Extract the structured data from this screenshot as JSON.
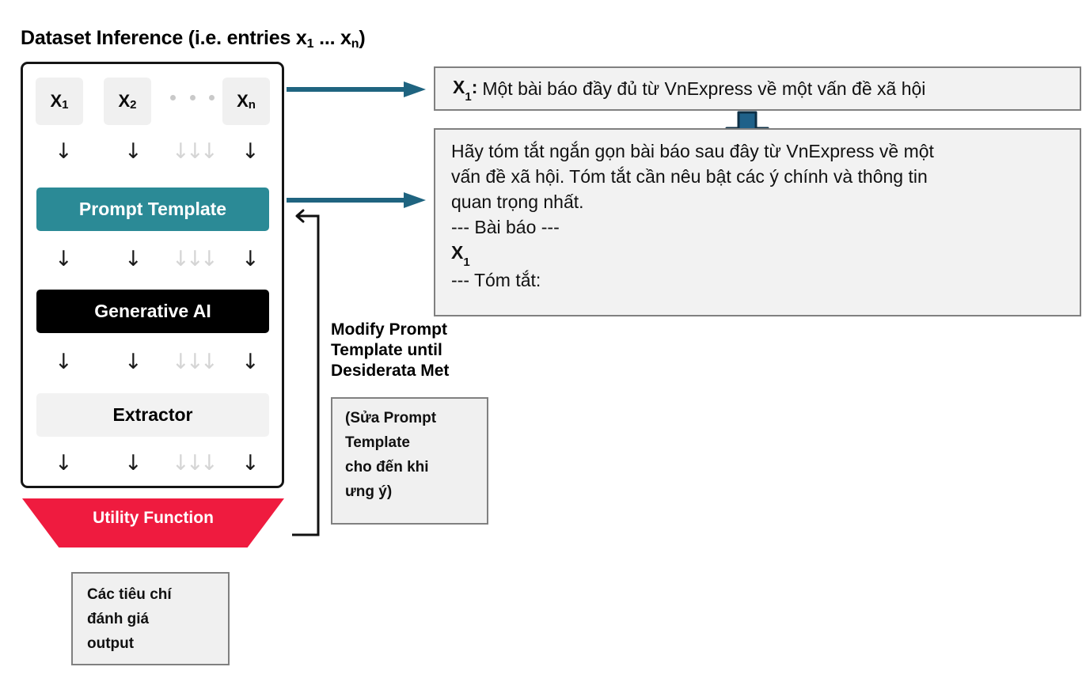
{
  "title": {
    "prefix": "Dataset Inference (i.e. entries x",
    "sub1": "1",
    "middle": " ... x",
    "sub2": "n",
    "suffix": ")",
    "full": "Dataset Inference (i.e. entries x1 ... xn)"
  },
  "pipeline": {
    "entries": [
      {
        "label": "X",
        "sub": "1"
      },
      {
        "label": "X",
        "sub": "2"
      },
      {
        "label": "X",
        "sub": "n"
      }
    ],
    "ellipsis": "• • •",
    "stages": [
      {
        "id": "prompt-template",
        "label": "Prompt Template",
        "color": "#2b8a96",
        "text_color": "#ffffff"
      },
      {
        "id": "generative-ai",
        "label": "Generative AI",
        "color": "#000000",
        "text_color": "#ffffff"
      },
      {
        "id": "extractor",
        "label": "Extractor",
        "color": "#f2f2f2",
        "text_color": "#000000"
      }
    ],
    "utility_function": {
      "label": "Utility Function",
      "color": "#ef1b3f",
      "text_color": "#ffffff"
    },
    "arrow_glyph": "↓"
  },
  "feedback": {
    "caption_line1": "Modify Prompt",
    "caption_line2": "Template until",
    "caption_line3": "Desiderata Met",
    "note_line1": "(Sửa Prompt",
    "note_line2": "Template",
    "note_line3": "cho đến khi",
    "note_line4": "ưng ý)"
  },
  "criteria": {
    "line1": "Các tiêu chí",
    "line2": "đánh giá",
    "line3": "output"
  },
  "example_entry": {
    "key": "X",
    "key_sub": "1",
    "colon": ":",
    "text": "Một bài báo đầy đủ từ VnExpress về một vấn đề xã hội"
  },
  "prompt_example": {
    "line1": "Hãy tóm tắt ngắn gọn bài báo sau đây từ VnExpress về một",
    "line2": "vấn đề xã hội. Tóm tắt cần nêu bật các ý chính và thông tin",
    "line3": "quan trọng nhất.",
    "line4": "--- Bài báo ---",
    "line5_x": "X",
    "line5_sub": "1",
    "line6": "--- Tóm tắt:"
  },
  "colors": {
    "teal_arrow": "#1f6480",
    "blue_down_arrow": "#1f6189",
    "red_banner": "#ef1b3f",
    "teal_box": "#2b8a96",
    "box_fill": "#f2f2f2",
    "box_border": "#808080"
  }
}
